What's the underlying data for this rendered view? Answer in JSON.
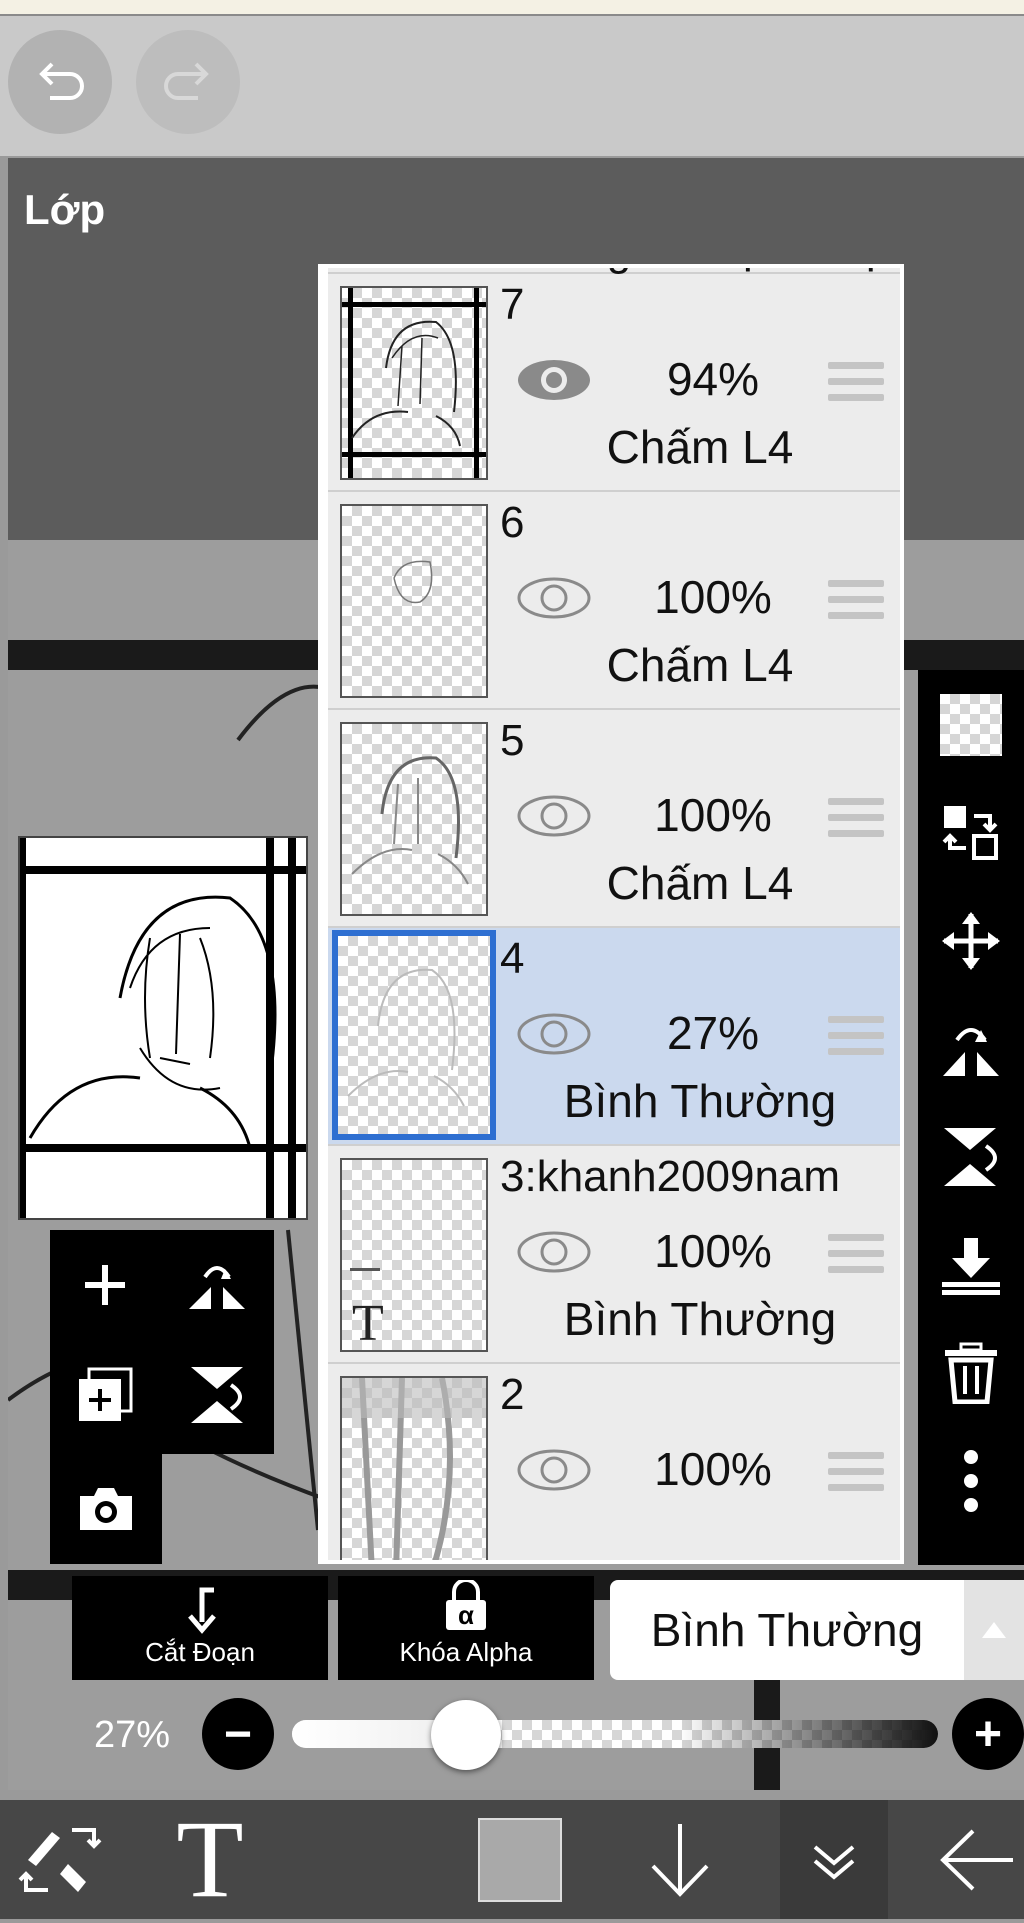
{
  "panel": {
    "title": "Lớp"
  },
  "layers": [
    {
      "name": "Không Có Lựa Chọn"
    },
    {
      "name": "7",
      "opacity": "94%",
      "blend": "Chấm L4",
      "visible": true
    },
    {
      "name": "6",
      "opacity": "100%",
      "blend": "Chấm L4",
      "visible": true
    },
    {
      "name": "5",
      "opacity": "100%",
      "blend": "Chấm L4",
      "visible": true
    },
    {
      "name": "4",
      "opacity": "27%",
      "blend": "Bình Thường",
      "visible": true,
      "selected": true
    },
    {
      "name": "3:khanh2009nam",
      "opacity": "100%",
      "blend": "Bình Thường",
      "visible": true
    },
    {
      "name": "2",
      "opacity": "100%",
      "visible": true
    }
  ],
  "actions": {
    "clipping": "Cắt Đoạn",
    "alpha_lock": "Khóa Alpha",
    "alpha_symbol": "α"
  },
  "blend_mode": {
    "current": "Bình Thường"
  },
  "opacity": {
    "label": "27%",
    "value": 0.27,
    "minus": "−",
    "plus": "+"
  },
  "bottom_bar": {
    "text_tool": "T"
  },
  "colors": {
    "selected_row": "#cbd9ee",
    "selected_border": "#2e6fd1"
  }
}
